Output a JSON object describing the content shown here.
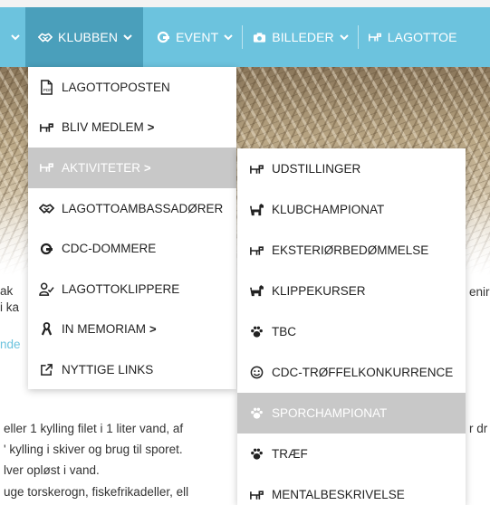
{
  "colors": {
    "nav_bg": "#6cc3de",
    "nav_active_bg": "#4a9fbb",
    "menu_hover_bg": "#c8c8c8",
    "text": "#222222"
  },
  "nav": {
    "items": [
      {
        "label": "KLUBBEN",
        "icon": "handshake-icon"
      },
      {
        "label": "EVENT",
        "icon": "dog-icon"
      },
      {
        "label": "BILLEDER",
        "icon": "camera-icon"
      },
      {
        "label": "LAGOTTOE",
        "icon": "dog-outline-icon"
      }
    ]
  },
  "menu_klubben": [
    {
      "label": "LAGOTTOPOSTEN",
      "icon": "pdf-file-icon"
    },
    {
      "label": "BLIV MEDLEM",
      "icon": "dog-outline-icon",
      "submenu": true
    },
    {
      "label": "AKTIVITETER",
      "icon": "dog-outline-icon",
      "submenu": true,
      "active": true
    },
    {
      "label": "LAGOTTOAMBASSADØRER",
      "icon": "handshake-icon"
    },
    {
      "label": "CDC-DOMMERE",
      "icon": "dog-icon"
    },
    {
      "label": "LAGOTTOKLIPPERE",
      "icon": "user-check-icon"
    },
    {
      "label": "IN MEMORIAM",
      "icon": "ribbon-icon",
      "submenu": true
    },
    {
      "label": "NYTTIGE LINKS",
      "icon": "external-link-icon"
    }
  ],
  "menu_aktiviteter": [
    {
      "label": "UDSTILLINGER",
      "icon": "dog-outline-icon"
    },
    {
      "label": "KLUBCHAMPIONAT",
      "icon": "dog-solid-icon"
    },
    {
      "label": "EKSTERIØRBEDØMMELSE",
      "icon": "dog-outline-icon"
    },
    {
      "label": "KLIPPEKURSER",
      "icon": "dog-solid-icon"
    },
    {
      "label": "TBC",
      "icon": "paw-icon"
    },
    {
      "label": "CDC-TRØFFELKONKURRENCE",
      "icon": "smiley-icon"
    },
    {
      "label": "SPORCHAMPIONAT",
      "icon": "paw-icon",
      "active": true
    },
    {
      "label": "TRÆF",
      "icon": "paw-icon"
    },
    {
      "label": "MENTALBESKRIVELSE",
      "icon": "dog-outline-icon"
    }
  ],
  "submenu_arrow": ">",
  "background_text": {
    "frag_ak": "ak",
    "frag_ka": "i ka",
    "frag_nde": "nde",
    "frag_enir": "enir",
    "line1": "eller 1 kylling filet i 1 liter vand, af",
    "line1_end": "r dr",
    "line2": "' kylling i skiver og brug til sporet.",
    "line3": "lver opløst i vand.",
    "line4": "uge torskerogn, fiskefrikadeller, ell"
  }
}
